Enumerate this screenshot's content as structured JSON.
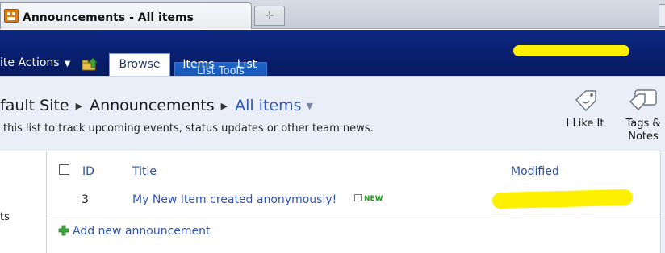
{
  "browser": {
    "tab_title": "Announcements - All items",
    "new_tab_glyph": "⊹"
  },
  "ribbon": {
    "site_actions": "ite Actions",
    "tabs": [
      {
        "label": "Browse",
        "selected": true
      },
      {
        "label": "Items",
        "selected": false
      },
      {
        "label": "List",
        "selected": false
      }
    ],
    "contextual_group": "List Tools"
  },
  "breadcrumb": {
    "site": "fault Site",
    "list": "Announcements",
    "view": "All items"
  },
  "description": "this list to track upcoming events, status updates or other team news.",
  "social": {
    "i_like_it": "I Like It",
    "tags_line1": "Tags &",
    "tags_line2": "Notes"
  },
  "quicklaunch": {
    "item": "ts"
  },
  "table": {
    "columns": [
      "ID",
      "Title",
      "Modified"
    ],
    "rows": [
      {
        "id": "3",
        "title": "My New Item created anonymously!",
        "badge": "NEW"
      }
    ]
  },
  "add_new": "Add new announcement",
  "colors": {
    "ribbon": "#0a1f6e",
    "link": "#2f55b8",
    "redaction": "#ffef00"
  }
}
